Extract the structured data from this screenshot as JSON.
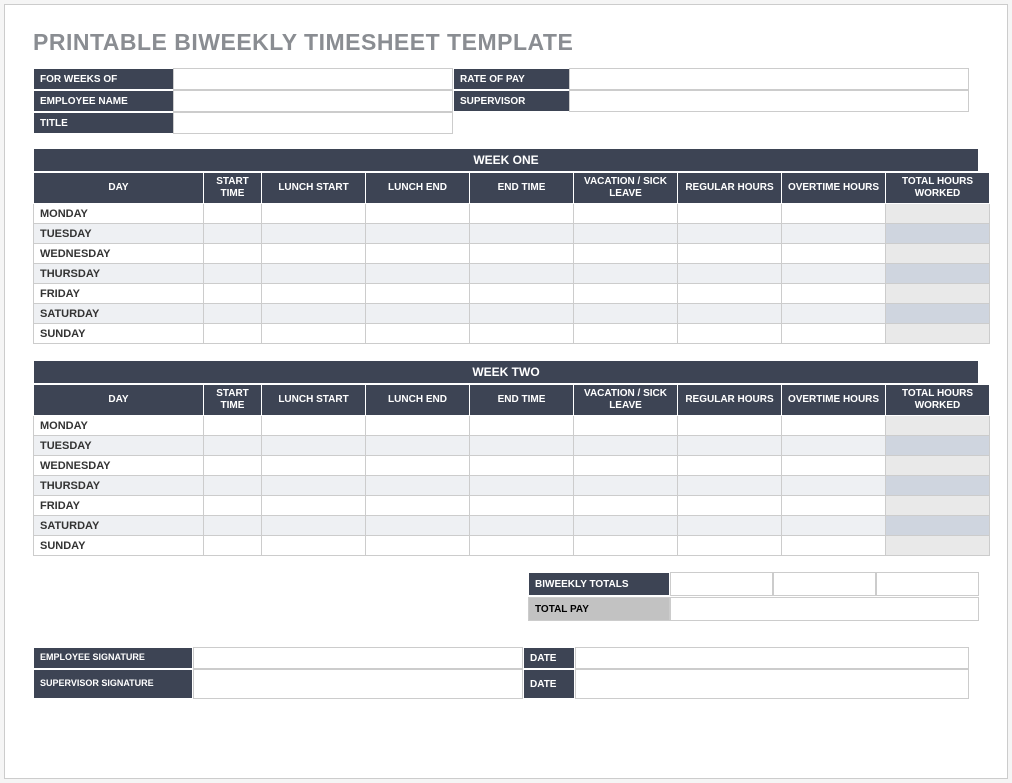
{
  "title": "PRINTABLE BIWEEKLY TIMESHEET TEMPLATE",
  "info": {
    "for_weeks_of_label": "FOR WEEKS OF",
    "for_weeks_of_value": "",
    "rate_of_pay_label": "RATE OF PAY",
    "rate_of_pay_value": "",
    "employee_name_label": "EMPLOYEE NAME",
    "employee_name_value": "",
    "supervisor_label": "SUPERVISOR",
    "supervisor_value": "",
    "title_label": "TITLE",
    "title_value": ""
  },
  "week_headers": {
    "day": "DAY",
    "start_time": "START TIME",
    "lunch_start": "LUNCH START",
    "lunch_end": "LUNCH END",
    "end_time": "END TIME",
    "vacation_sick": "VACATION / SICK LEAVE",
    "regular_hours": "REGULAR HOURS",
    "overtime_hours": "OVERTIME HOURS",
    "total_hours": "TOTAL HOURS WORKED"
  },
  "weeks": [
    {
      "label": "WEEK ONE",
      "days": [
        "MONDAY",
        "TUESDAY",
        "WEDNESDAY",
        "THURSDAY",
        "FRIDAY",
        "SATURDAY",
        "SUNDAY"
      ]
    },
    {
      "label": "WEEK TWO",
      "days": [
        "MONDAY",
        "TUESDAY",
        "WEDNESDAY",
        "THURSDAY",
        "FRIDAY",
        "SATURDAY",
        "SUNDAY"
      ]
    }
  ],
  "totals": {
    "biweekly_label": "BIWEEKLY TOTALS",
    "total_pay_label": "TOTAL PAY"
  },
  "signatures": {
    "employee_signature_label": "EMPLOYEE SIGNATURE",
    "supervisor_signature_label": "SUPERVISOR SIGNATURE",
    "date_label": "DATE"
  }
}
